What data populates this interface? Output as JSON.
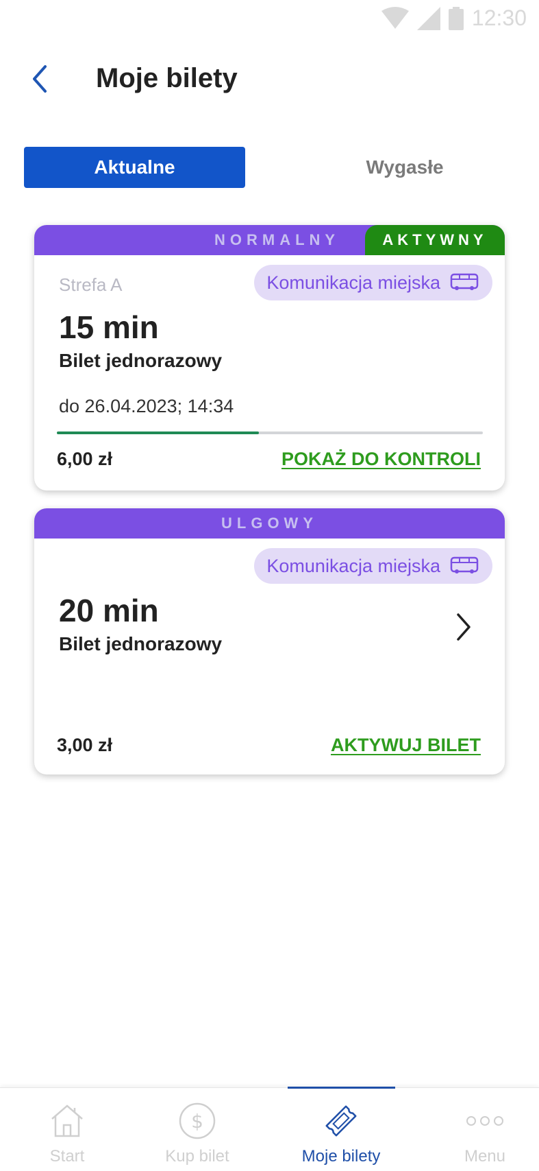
{
  "status_bar": {
    "time": "12:30",
    "icons": [
      "wifi-icon",
      "signal-icon",
      "battery-icon"
    ]
  },
  "header": {
    "title": "Moje bilety",
    "back_icon": "chevron-left-icon"
  },
  "tabs": {
    "active": "Aktualne",
    "inactive": "Wygasłe"
  },
  "tickets": [
    {
      "category": "NORMALNY",
      "status": "AKTYWNY",
      "zone": "Strefa A",
      "transport": "Komunikacja miejska",
      "transport_icon": "bus-icon",
      "duration": "15 min",
      "type": "Bilet jednorazowy",
      "validity": "do 26.04.2023; 14:34",
      "progress_fraction": 0.475,
      "price": "6,00 zł",
      "action": "POKAŻ DO KONTROLI"
    },
    {
      "category": "ULGOWY",
      "transport": "Komunikacja miejska",
      "transport_icon": "bus-icon",
      "duration": "20 min",
      "type": "Bilet jednorazowy",
      "price": "3,00 zł",
      "action": "AKTYWUJ BILET",
      "detail_icon": "chevron-right-icon"
    }
  ],
  "bottom_nav": [
    {
      "label": "Start",
      "icon": "home-icon",
      "active": false
    },
    {
      "label": "Kup bilet",
      "icon": "dollar-coin-icon",
      "active": false
    },
    {
      "label": "Moje bilety",
      "icon": "ticket-icon",
      "active": true
    },
    {
      "label": "Menu",
      "icon": "more-dots-icon",
      "active": false
    }
  ],
  "colors": {
    "primary": "#1255c9",
    "ticket_band": "#7b4fe3",
    "active_status": "#1f8a13",
    "action_link": "#2e9c1e",
    "chip_bg": "#e3dbf7",
    "nav_active": "#1f4fa8"
  }
}
